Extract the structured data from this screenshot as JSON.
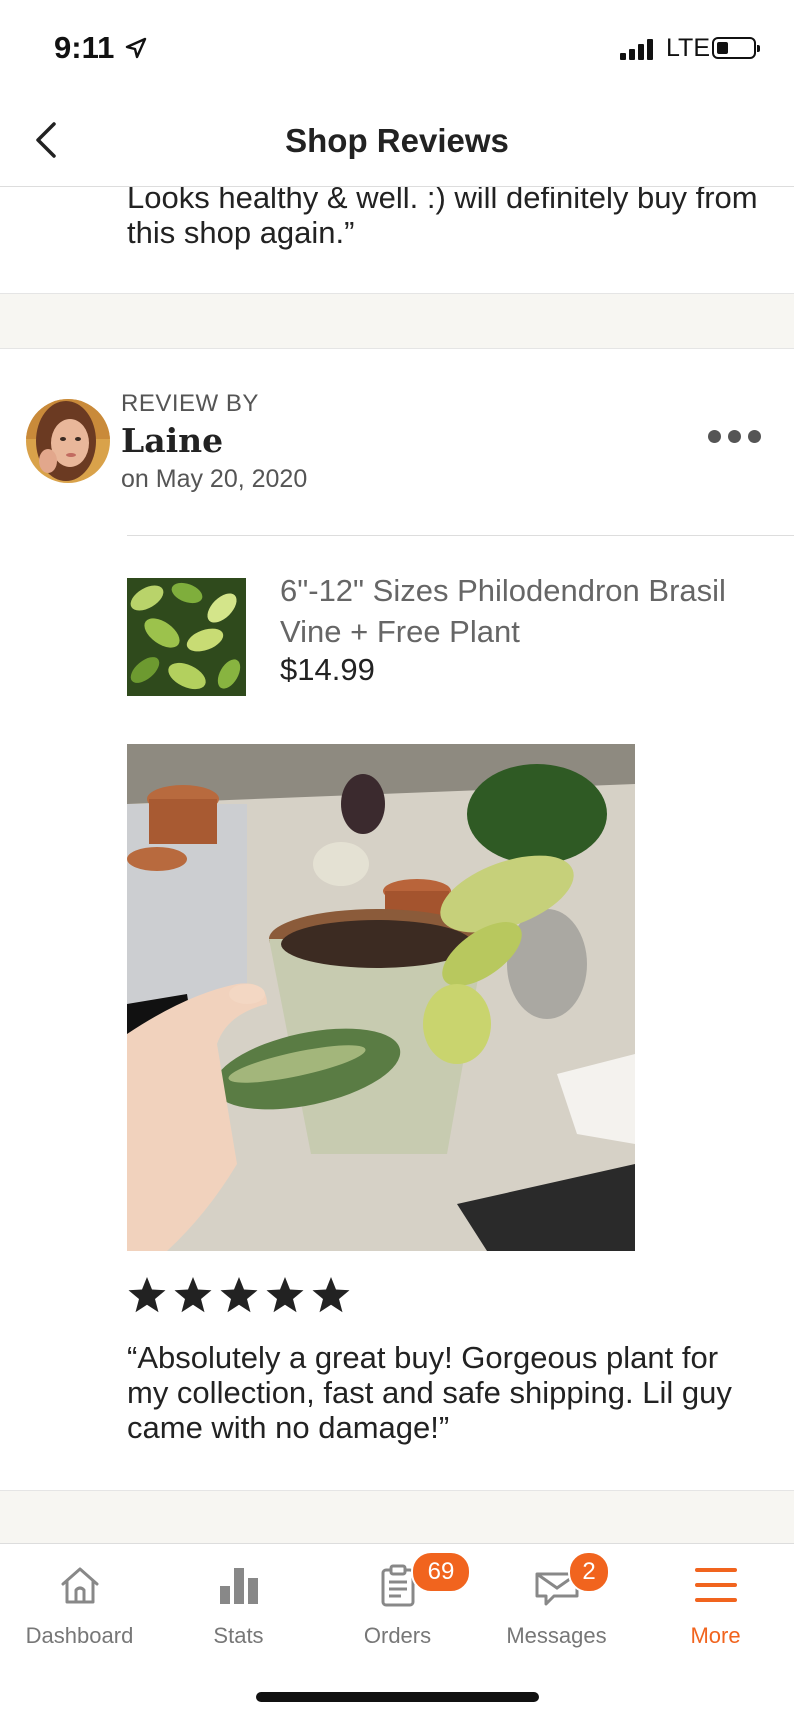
{
  "status_bar": {
    "time": "9:11",
    "network": "LTE"
  },
  "header": {
    "title": "Shop Reviews"
  },
  "previous_review": {
    "text": "Looks healthy & well. :) will definitely buy from this shop again.”"
  },
  "review": {
    "label": "REVIEW BY",
    "reviewer": "Laine",
    "date": "on May 20, 2020",
    "product": {
      "title": "6\"-12\" Sizes Philodendron Brasil Vine + Free Plant",
      "price": "$14.99"
    },
    "rating": 5,
    "text": "“Absolutely a great buy! Gorgeous plant for my collection, fast and safe shipping. Lil guy came with no damage!”"
  },
  "tab_bar": {
    "tabs": [
      {
        "label": "Dashboard",
        "icon": "home-icon"
      },
      {
        "label": "Stats",
        "icon": "bar-chart-icon"
      },
      {
        "label": "Orders",
        "icon": "clipboard-icon",
        "badge": "69"
      },
      {
        "label": "Messages",
        "icon": "envelope-icon",
        "badge": "2"
      },
      {
        "label": "More",
        "icon": "menu-icon",
        "active": true
      }
    ]
  },
  "colors": {
    "accent": "#f1641e",
    "muted": "#777777",
    "band": "#f7f6f2"
  }
}
